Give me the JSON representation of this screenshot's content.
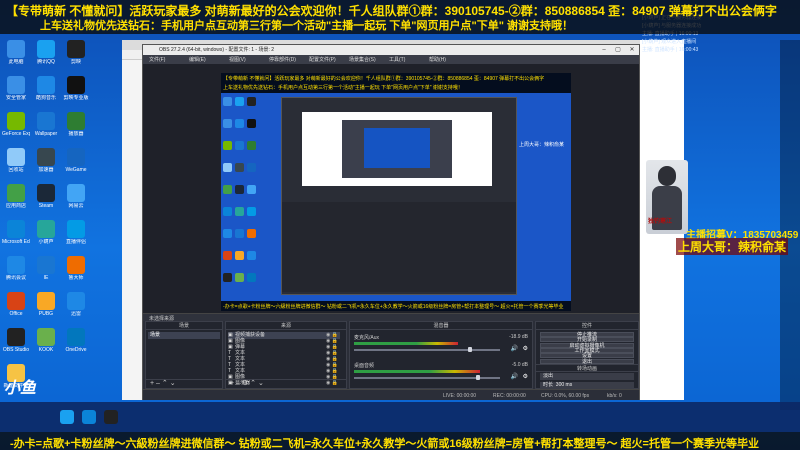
{
  "overlay": {
    "banner_line1": "【专带萌新 不懂就问】活跃玩家最多 对萌新最好的公会欢迎你！千人组队群①群：390105745-②群：850886854  歪：84907  弹幕打不出公会俩字",
    "banner_line2": "上车送礼物优先送钻石：手机用户点互动第三行第一个活动\"主播一起玩 下单\"网页用户点\"下单\" 谢谢支持哦！",
    "bottom_line": "-办卡=点歌+卡粉丝牌～六級粉丝牌进微信群～ 钻粉或二飞机=永久车位+永久教学～火箭或16级粉丝牌=房管+帮打本整理号～ 超火=托管一个赛季光等毕业",
    "recruit": "主播招募V：1835703459",
    "lastweek": "上周大哥：辣积俞某",
    "person_caption": "独钓寒江",
    "side_logo": "小鱼"
  },
  "chat": {
    "lines": [
      "[小葫芦] 正在与服务器连接",
      "[小葫芦] 与服务器连接成功",
      "主播: 直播助手 | 16:00:13",
      "[小葫芦] 观众进入直播间",
      "主播: 直播助手 | 16:00:43"
    ]
  },
  "desktop": {
    "icons": [
      {
        "label": "此电脑",
        "color": "#3a8fe6"
      },
      {
        "label": "腾讯QQ",
        "color": "#1aa1f0"
      },
      {
        "label": "剪映",
        "color": "#222222"
      },
      {
        "label": "安全管家",
        "color": "#3a8fe6"
      },
      {
        "label": "酷狗音乐",
        "color": "#1e88e5"
      },
      {
        "label": "剪映专业版",
        "color": "#111111"
      },
      {
        "label": "GeForce Experience",
        "color": "#76b900"
      },
      {
        "label": "Wallpaper",
        "color": "#1976d2"
      },
      {
        "label": "播放器",
        "color": "#2e7d32"
      },
      {
        "label": "回收站",
        "color": "#90caf9"
      },
      {
        "label": "加速器",
        "color": "#37474f"
      },
      {
        "label": "WeGame",
        "color": "#1565c0"
      },
      {
        "label": "应用商店",
        "color": "#43a047"
      },
      {
        "label": "Steam",
        "color": "#1b2838"
      },
      {
        "label": "网易云",
        "color": "#42a5f5"
      },
      {
        "label": "Microsoft Edge",
        "color": "#0b84d8"
      },
      {
        "label": "小葫芦",
        "color": "#26a69a"
      },
      {
        "label": "直播伴侣",
        "color": "#039be5"
      },
      {
        "label": "腾讯会议",
        "color": "#1e88e5"
      },
      {
        "label": "IE",
        "color": "#1976d2"
      },
      {
        "label": "鲁大师",
        "color": "#ef6c00"
      },
      {
        "label": "Office",
        "color": "#d84315"
      },
      {
        "label": "PUBG",
        "color": "#f9a825"
      },
      {
        "label": "迅雷",
        "color": "#1e88e5"
      },
      {
        "label": "OBS Studio",
        "color": "#222222"
      },
      {
        "label": "KOOK",
        "color": "#6ab04c"
      },
      {
        "label": "OneDrive",
        "color": "#0277bd"
      },
      {
        "label": "新建文件夹",
        "color": "#f6c344"
      }
    ]
  },
  "obs": {
    "title": "OBS 27.2.4 (64-bit, windows) - 配置文件: 1 - 场景: 2",
    "menu": [
      "文件(F)",
      "编辑(E)",
      "视图(V)",
      "停靠部件(D)",
      "配置文件(P)",
      "场景集合(S)",
      "工具(T)",
      "帮助(H)"
    ],
    "dock_titles": [
      "场景",
      "来源",
      "混音器",
      "转场动画",
      "控件"
    ],
    "no_source": "未选择来源",
    "scenes": [
      "场景"
    ],
    "sources": [
      {
        "icon": "▣",
        "name": "视频捕获设备"
      },
      {
        "icon": "▣",
        "name": "图像"
      },
      {
        "icon": "▣",
        "name": "弹幕"
      },
      {
        "icon": "T",
        "name": "文本"
      },
      {
        "icon": "T",
        "name": "文本"
      },
      {
        "icon": "T",
        "name": "文本"
      },
      {
        "icon": "T",
        "name": "文本"
      },
      {
        "icon": "▣",
        "name": "图像"
      },
      {
        "icon": "▣",
        "name": "显示器"
      }
    ],
    "mixer": [
      {
        "name": "麦克风/Aux",
        "db": "-18.9 dB",
        "level": 0.62,
        "volume": 0.8
      },
      {
        "name": "桌面音频",
        "db": "-5.0 dB",
        "level": 0.75,
        "volume": 0.86
      }
    ],
    "controls": [
      "停止推流",
      "开始录制",
      "启动虚拟摄像机",
      "工作室模式",
      "设置",
      "退出"
    ],
    "transition": {
      "label": "淡出",
      "duration_label": "时长",
      "duration": "300 ms"
    },
    "status": [
      "LIVE: 00:00:00",
      "REC: 00:00:00",
      "CPU: 0.0%, 60.00 fps",
      "kb/s: 0"
    ],
    "preview_banner1": "【专带萌新 不懂就问】活跃玩家最多 对萌新最好的公会欢迎你！千人组队群①群：390105745-②群：850886854  歪：84907  弹幕打不出公会俩字",
    "preview_banner2": "上车送礼物优先送钻石：手机用户点互动第三行第一个活动\"主播一起玩 下单\"网页用户点\"下单\" 谢谢支持哦！",
    "preview_bottom": "-办卡=点歌+卡粉丝牌～六級粉丝牌进微信群～ 钻粉或二飞机=永久车位+永久教学～火箭或16级粉丝牌=房管+帮打本整理号～ 超火=托管一个赛季光等毕业",
    "preview_side": "上周大哥：辣积俞某"
  },
  "colors": {
    "accent_yellow": "#ffe000",
    "desktop_blue": "#1173e0",
    "obs_dark": "#2b2e38"
  }
}
